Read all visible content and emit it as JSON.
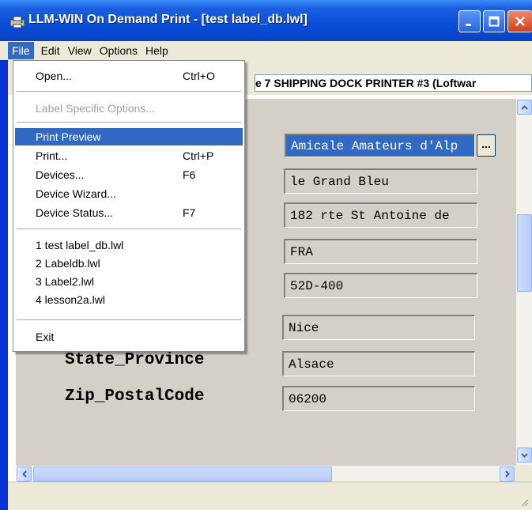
{
  "window": {
    "title": "LLM-WIN On Demand Print - [test label_db.lwl]",
    "colors": {
      "titlebar": "#0a4ed8",
      "menu_highlight": "#316ac5",
      "field_bg": "#d4d0c8"
    }
  },
  "menubar": {
    "items": [
      {
        "label": "File"
      },
      {
        "label": "Edit"
      },
      {
        "label": "View"
      },
      {
        "label": "Options"
      },
      {
        "label": "Help"
      }
    ]
  },
  "toolbar": {
    "printer_text": "e 7 SHIPPING DOCK PRINTER #3 (Loftwar"
  },
  "file_menu": {
    "items": [
      {
        "label": "Open...",
        "shortcut": "Ctrl+O"
      },
      {
        "label": "Label Specific Options...",
        "disabled": true
      },
      {
        "label": "Print Preview",
        "selected": true
      },
      {
        "label": "Print...",
        "shortcut": "Ctrl+P"
      },
      {
        "label": "Devices...",
        "shortcut": "F6"
      },
      {
        "label": "Device Wizard..."
      },
      {
        "label": "Device Status...",
        "shortcut": "F7"
      },
      {
        "label": "1 test label_db.lwl"
      },
      {
        "label": "2 Labeldb.lwl"
      },
      {
        "label": "3 Label2.lwl"
      },
      {
        "label": "4 lesson2a.lwl"
      },
      {
        "label": "Exit"
      }
    ]
  },
  "form": {
    "labels": [
      {
        "text": "State_Province"
      },
      {
        "text": "Zip_PostalCode"
      }
    ],
    "fields": [
      {
        "value": "Amicale Amateurs d'Alp",
        "selected": true
      },
      {
        "value": "le Grand Bleu"
      },
      {
        "value": "182 rte St Antoine de"
      },
      {
        "value": "FRA"
      },
      {
        "value": "52D-400"
      },
      {
        "value": "Nice"
      },
      {
        "value": "Alsace"
      },
      {
        "value": "06200"
      }
    ],
    "browse_label": "..."
  }
}
